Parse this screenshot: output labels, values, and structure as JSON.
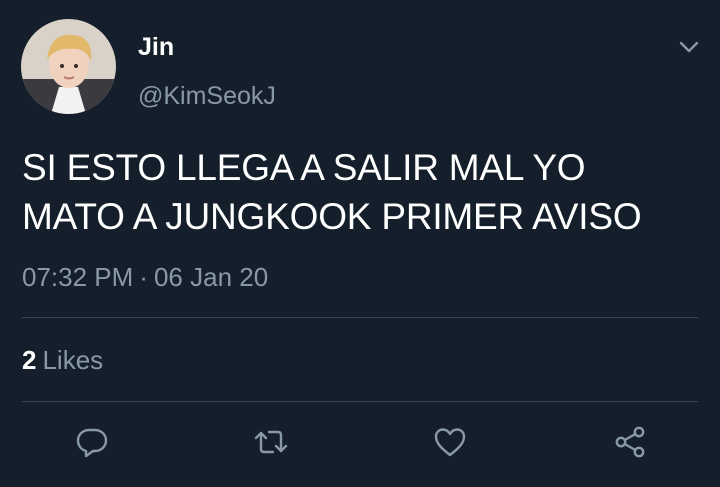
{
  "user": {
    "display_name": "Jin",
    "handle": "@KimSeokJ"
  },
  "tweet": {
    "text_lines": [
      "SI ESTO LLEGA A SALIR MAL YO",
      "MATO A JUNGKOOK PRIMER AVISO"
    ],
    "time": "07:32 PM",
    "separator": "·",
    "date": "06 Jan 20"
  },
  "stats": {
    "likes_count": "2",
    "likes_label": "Likes"
  },
  "actions": [
    {
      "icon": "reply-icon"
    },
    {
      "icon": "retweet-icon"
    },
    {
      "icon": "like-icon"
    },
    {
      "icon": "share-icon"
    }
  ],
  "colors": {
    "background": "#151f2b",
    "primary_text": "#ffffff",
    "secondary_text": "#8899a6",
    "divider": "#38444d"
  }
}
